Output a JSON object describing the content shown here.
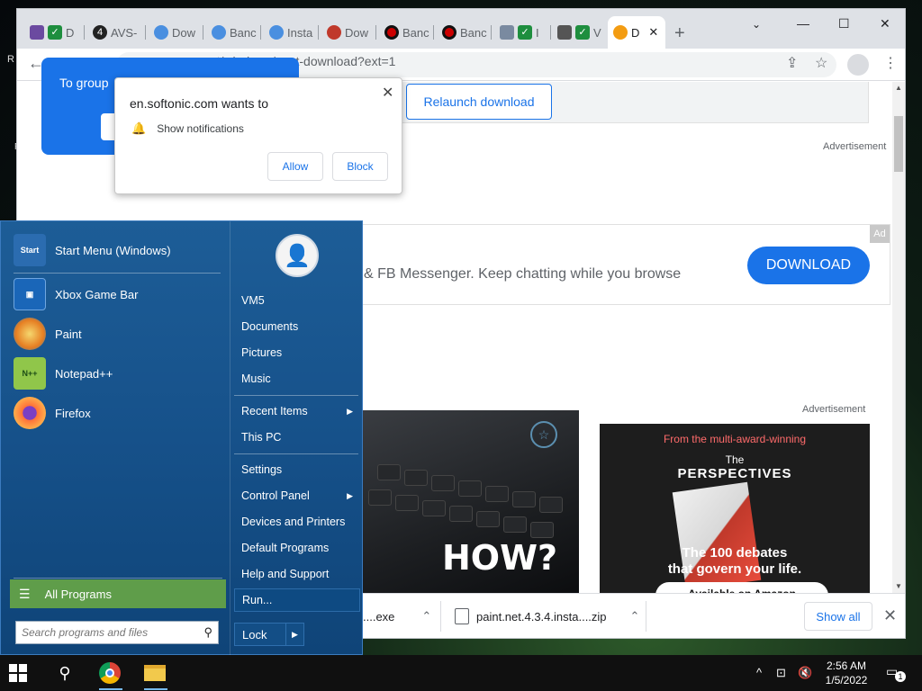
{
  "browser": {
    "tabs": [
      {
        "label": "D",
        "favicon": "mixed-icon"
      },
      {
        "label": "AVS-",
        "favicon": "avs-icon"
      },
      {
        "label": "Dow",
        "favicon": "b-icon"
      },
      {
        "label": "Banc",
        "favicon": "b-icon"
      },
      {
        "label": "Insta",
        "favicon": "b-icon"
      },
      {
        "label": "Dow",
        "favicon": "red-circle-icon"
      },
      {
        "label": "Banc",
        "favicon": "red-dot-icon"
      },
      {
        "label": "Banc",
        "favicon": "red-dot-icon"
      },
      {
        "label": "I",
        "favicon": "mixed-icon"
      },
      {
        "label": "V",
        "favicon": "mixed-icon"
      },
      {
        "label": "D",
        "favicon": "avast-icon"
      }
    ],
    "url": "avast/windows/post-download?ext=1",
    "window_controls": {
      "minimize": "—",
      "maximize": "☐",
      "close": "✕"
    }
  },
  "group_tip": {
    "text": "To group"
  },
  "notification_popup": {
    "title": "en.softonic.com wants to",
    "permission": "Show notifications",
    "allow_label": "Allow",
    "block_label": "Block"
  },
  "page": {
    "relaunch_label": "Relaunch download",
    "advertisement_label": "Advertisement",
    "banner": {
      "ad_badge": "Ad",
      "text": "& FB Messenger. Keep chatting while you browse",
      "download_label": "DOWNLOAD"
    },
    "laptop_ad": {
      "text": "HOW?"
    },
    "book_ad": {
      "tagline": "From the multi-award-winning",
      "the": "The",
      "title": "PERSPECTIVES",
      "headline_1": "The 100 debates",
      "headline_2": "that govern your life.",
      "cta": "Available on Amazon"
    }
  },
  "downloads": {
    "item1": "....exe",
    "item2": "paint.net.4.3.4.insta....zip",
    "show_all": "Show all"
  },
  "start_menu": {
    "programs": [
      {
        "label": "Start Menu (Windows)",
        "icon": "start-menu-icon"
      },
      {
        "label": "Xbox Game Bar",
        "icon": "xbox-game-bar-icon"
      },
      {
        "label": "Paint",
        "icon": "paint-icon"
      },
      {
        "label": "Notepad++",
        "icon": "notepad-plus-icon"
      },
      {
        "label": "Firefox",
        "icon": "firefox-icon"
      }
    ],
    "all_programs": "All Programs",
    "search_placeholder": "Search programs and files",
    "right_links": {
      "user": "VM5",
      "documents": "Documents",
      "pictures": "Pictures",
      "music": "Music",
      "recent_items": "Recent Items",
      "this_pc": "This PC",
      "settings": "Settings",
      "control_panel": "Control Panel",
      "devices_printers": "Devices and Printers",
      "default_programs": "Default Programs",
      "help_support": "Help and Support",
      "run": "Run..."
    },
    "lock_label": "Lock"
  },
  "taskbar": {
    "time": "2:56 AM",
    "date": "1/5/2022",
    "notification_count": "1"
  },
  "desktop": {
    "side_r": "R",
    "side_f": "F"
  }
}
